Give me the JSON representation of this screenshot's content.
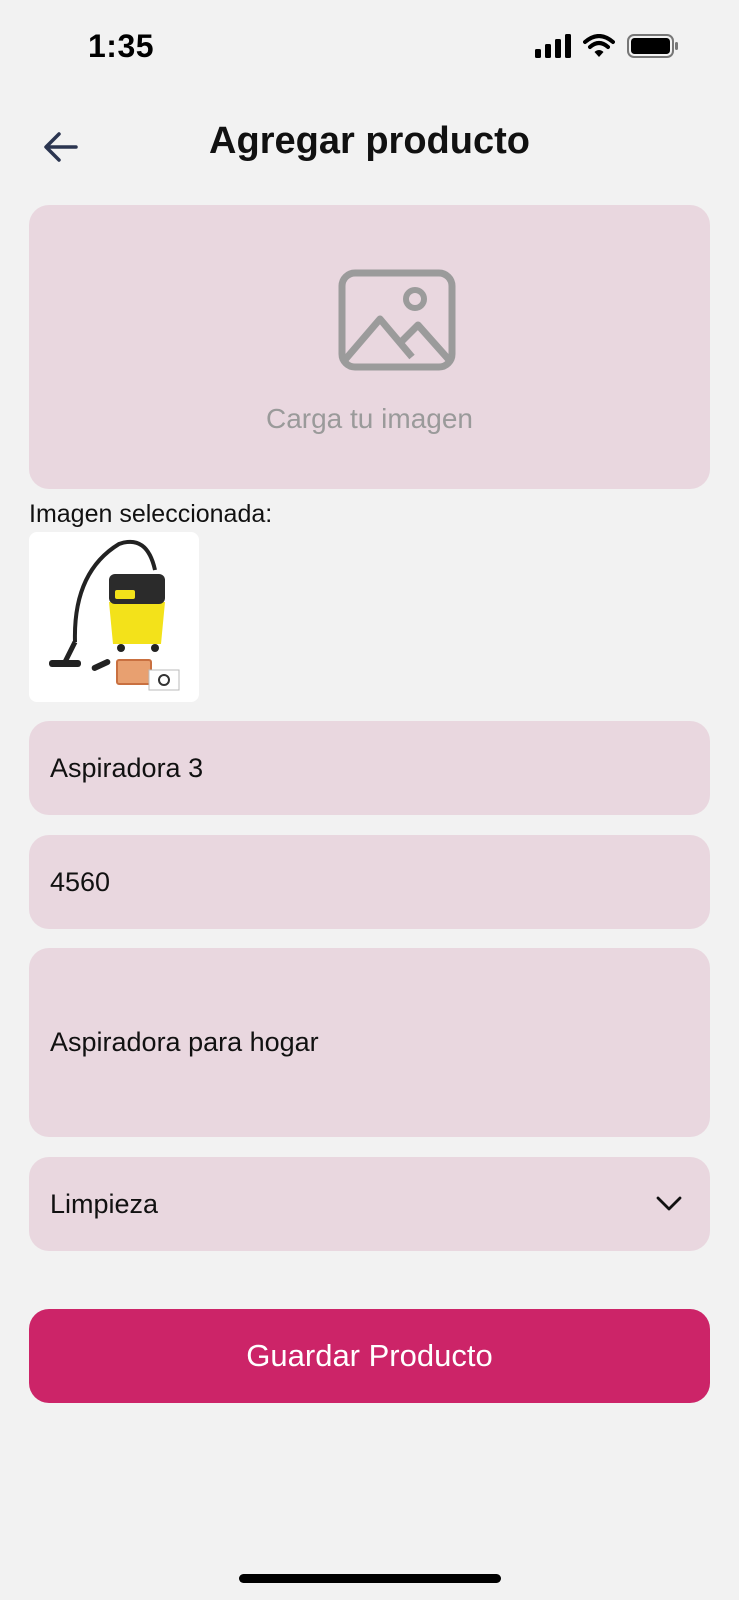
{
  "status_bar": {
    "time": "1:35",
    "icons": [
      "signal-icon",
      "wifi-icon",
      "battery-icon"
    ]
  },
  "header": {
    "title": "Agregar producto",
    "back_icon": "arrow-left-icon"
  },
  "upload": {
    "label": "Carga tu imagen",
    "icon": "image-placeholder-icon"
  },
  "selected_image": {
    "label": "Imagen seleccionada:",
    "alt": "wet-dry-vacuum-photo"
  },
  "form": {
    "name_value": "Aspiradora 3",
    "price_value": "4560",
    "description_value": "Aspiradora para hogar",
    "category_value": "Limpieza",
    "category_icon": "chevron-down-icon"
  },
  "actions": {
    "save_label": "Guardar Producto"
  },
  "colors": {
    "background": "#f2f2f2",
    "field_bg": "#e9d7df",
    "primary": "#cc2468",
    "placeholder_text": "#9a9a9a"
  }
}
